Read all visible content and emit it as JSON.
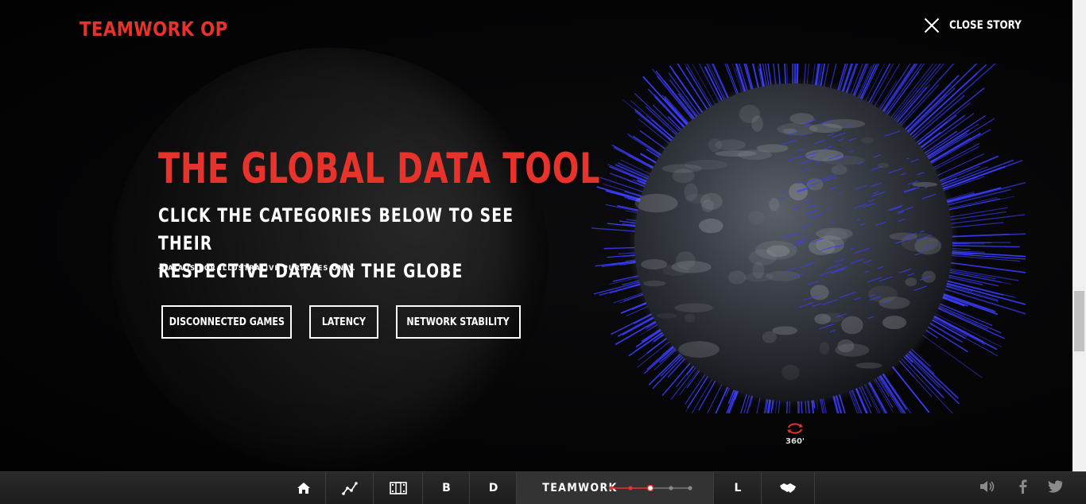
{
  "header": {
    "brand": "TEAMWORK OP",
    "close_label": "CLOSE STORY"
  },
  "hero": {
    "title": "THE GLOBAL DATA TOOL",
    "subtitle_line1": "CLICK THE CATEGORIES BELOW TO SEE THEIR",
    "subtitle_line2": "RESPECTIVE DATA ON THE GLOBE",
    "note": "-DATA IS FOR ILLUSTRATIVE PURPOSES ONLY."
  },
  "categories": [
    {
      "label": "DISCONNECTED GAMES"
    },
    {
      "label": "LATENCY"
    },
    {
      "label": "NETWORK STABILITY"
    }
  ],
  "globe": {
    "rotate_label": "360'",
    "bar_color": "#3a3dff"
  },
  "bottom_nav": {
    "items": [
      {
        "icon": "home-icon",
        "label": ""
      },
      {
        "icon": "graph-icon",
        "label": ""
      },
      {
        "icon": "film-icon",
        "label": ""
      },
      {
        "icon": "",
        "label": "B"
      },
      {
        "icon": "",
        "label": "D"
      },
      {
        "icon": "",
        "label": "TEAMWORK"
      },
      {
        "icon": "",
        "label": "L"
      },
      {
        "icon": "handshake-icon",
        "label": ""
      }
    ],
    "progress_steps": 5,
    "progress_current": 3
  },
  "colors": {
    "accent": "#e8332c",
    "background": "#050505",
    "bar": "#2a2a2a"
  }
}
